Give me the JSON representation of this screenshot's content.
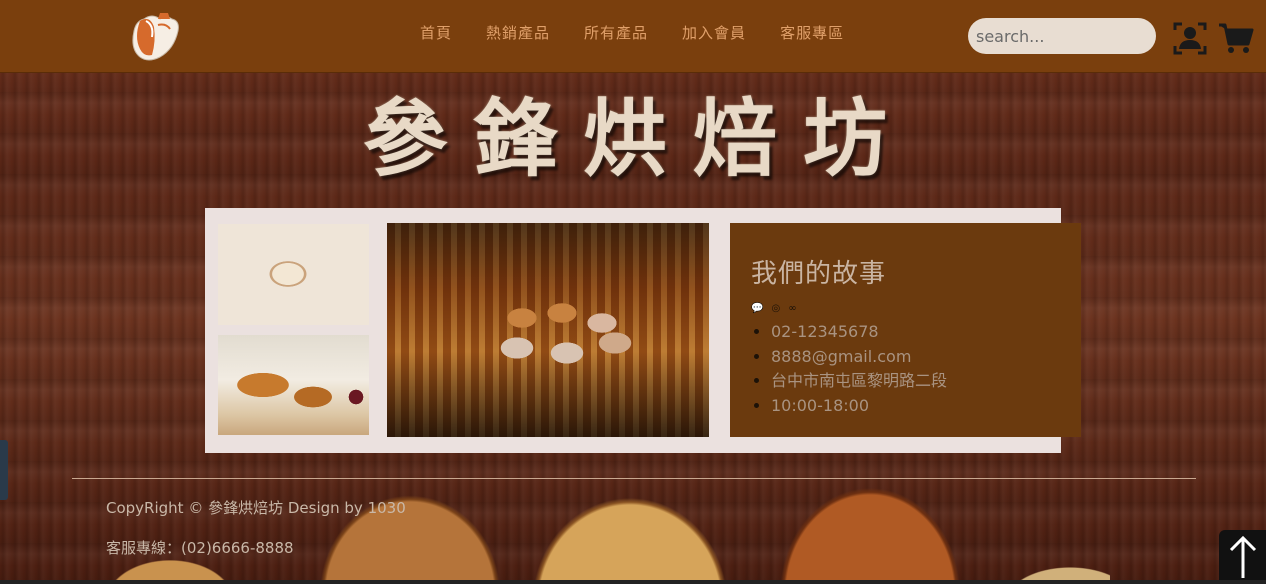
{
  "header": {
    "logo_icon": "bread-logo-icon",
    "nav": [
      {
        "label": "首頁"
      },
      {
        "label": "熱銷產品"
      },
      {
        "label": "所有產品"
      },
      {
        "label": "加入會員"
      },
      {
        "label": "客服專區"
      }
    ],
    "search": {
      "placeholder": "search...",
      "value": ""
    },
    "user_icon": "user-account-icon",
    "cart_icon": "shopping-cart-icon"
  },
  "hero": {
    "title": "參鋒烘焙坊"
  },
  "story": {
    "heading": "我們的故事",
    "social_icons": [
      "line-icon",
      "instagram-icon",
      "link-icon"
    ],
    "social_glyphs": [
      "💬",
      "◎",
      "∞"
    ],
    "items": [
      {
        "text": "02-12345678"
      },
      {
        "text": "8888@gmail.com"
      },
      {
        "text": "台中市南屯區黎明路二段"
      },
      {
        "text": "10:00-18:00"
      }
    ]
  },
  "footer": {
    "copyright": "CopyRight © 參鋒烘焙坊 Design by 1030",
    "service_line": "客服專線：(02)6666-8888"
  },
  "back_to_top": {
    "icon": "arrow-up-icon",
    "glyph": "🡑"
  },
  "colors": {
    "header_bg": "#7a3f0d",
    "nav_text": "#e0a06a",
    "story_bg": "#6b3a0e",
    "panel_bg": "#ebe1df",
    "title_text": "#e8d9c6"
  }
}
